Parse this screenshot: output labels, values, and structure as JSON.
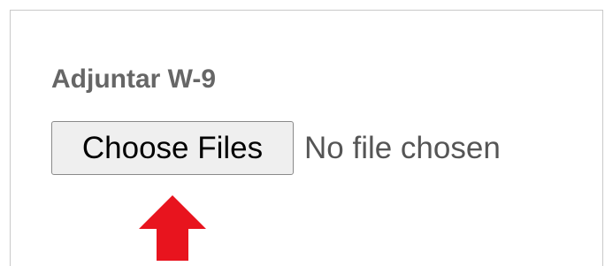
{
  "form": {
    "label": "Adjuntar W-9",
    "file_input": {
      "button_label": "Choose Files",
      "status_text": "No file chosen"
    }
  },
  "annotation": {
    "arrow_icon": "up-arrow-icon",
    "arrow_color": "#e8141e"
  },
  "colors": {
    "label_text": "#666666",
    "button_bg": "#efefef",
    "button_border": "#8a8a8a",
    "frame_border": "#c9c9c9"
  }
}
